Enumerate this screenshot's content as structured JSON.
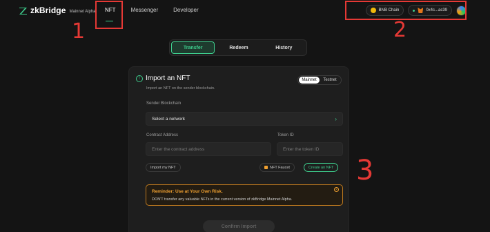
{
  "header": {
    "logo_name": "zkBridge",
    "logo_sub": "Mainnet Alpha",
    "nav": [
      "NFT",
      "Messenger",
      "Developer"
    ],
    "chain": "BNB Chain",
    "wallet": "0x4c...ac39"
  },
  "annotations": [
    "1",
    "2",
    "3"
  ],
  "tabs": [
    "Transfer",
    "Redeem",
    "History"
  ],
  "card": {
    "title": "Import an NFT",
    "subtitle": "Import an NFT on the sender blockchain.",
    "toggle": [
      "Mainnet",
      "Testnet"
    ],
    "sender_label": "Sender Blockchain",
    "sender_value": "Select a network",
    "contract_label": "Contract Address",
    "contract_placeholder": "Enter the contract address",
    "token_label": "Token ID",
    "token_placeholder": "Enter the token ID",
    "import_my": "Import my NFT",
    "faucet": "NFT Faucet",
    "create": "Create an NFT",
    "reminder_title": "Reminder: Use at Your Own Risk.",
    "reminder_text": "DON'T transfer any valuable NFTs in the current version of zkBridge Mainnet Alpha.",
    "confirm": "Confirm Import"
  },
  "colors": {
    "accent": "#3ecf8e",
    "annotation": "#e53935",
    "warning": "#f0a030"
  }
}
